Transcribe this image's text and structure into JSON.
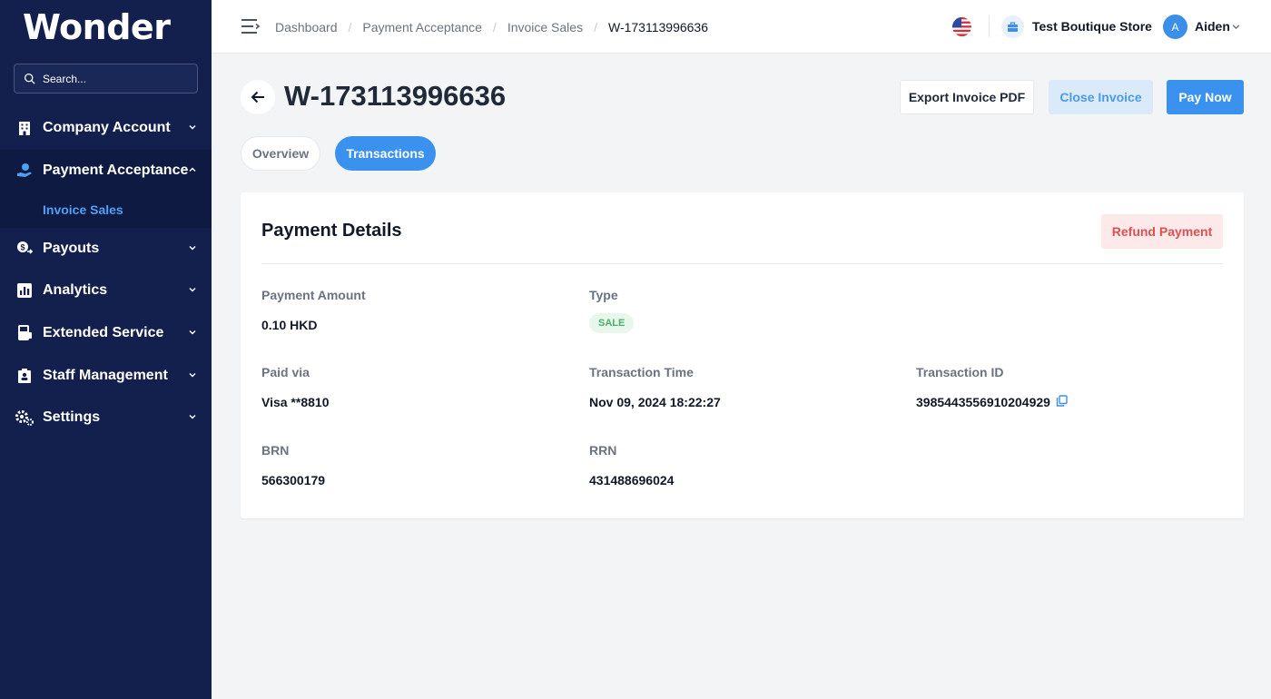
{
  "sidebar": {
    "logo": "Wonder",
    "search_placeholder": "Search...",
    "items": [
      {
        "label": "Company Account"
      },
      {
        "label": "Payment Acceptance"
      },
      {
        "label": "Payouts"
      },
      {
        "label": "Analytics"
      },
      {
        "label": "Extended Service"
      },
      {
        "label": "Staff Management"
      },
      {
        "label": "Settings"
      }
    ],
    "sub_item": "Invoice Sales"
  },
  "topbar": {
    "breadcrumbs": [
      "Dashboard",
      "Payment Acceptance",
      "Invoice Sales",
      "W-173113996636"
    ],
    "store_name": "Test Boutique Store",
    "avatar_initial": "A",
    "user_name": "Aiden"
  },
  "header": {
    "title": "W-173113996636",
    "export_label": "Export Invoice PDF",
    "close_label": "Close Invoice",
    "pay_label": "Pay Now"
  },
  "tabs": [
    "Overview",
    "Transactions"
  ],
  "card": {
    "title": "Payment Details",
    "refund_label": "Refund Payment",
    "fields": {
      "payment_amount": {
        "label": "Payment Amount",
        "value": "0.10 HKD"
      },
      "type": {
        "label": "Type",
        "value": "SALE"
      },
      "paid_via": {
        "label": "Paid via",
        "value": "Visa **8810"
      },
      "transaction_time": {
        "label": "Transaction Time",
        "value": "Nov 09, 2024 18:22:27"
      },
      "transaction_id": {
        "label": "Transaction ID",
        "value": "3985443556910204929"
      },
      "brn": {
        "label": "BRN",
        "value": "566300179"
      },
      "rrn": {
        "label": "RRN",
        "value": "431488696024"
      }
    }
  },
  "colors": {
    "sidebar_bg": "#13204d",
    "accent": "#3b92ee",
    "active_link": "#4ea1f3",
    "refund_text": "#d9534f",
    "sale_badge": "#4caf6a"
  }
}
